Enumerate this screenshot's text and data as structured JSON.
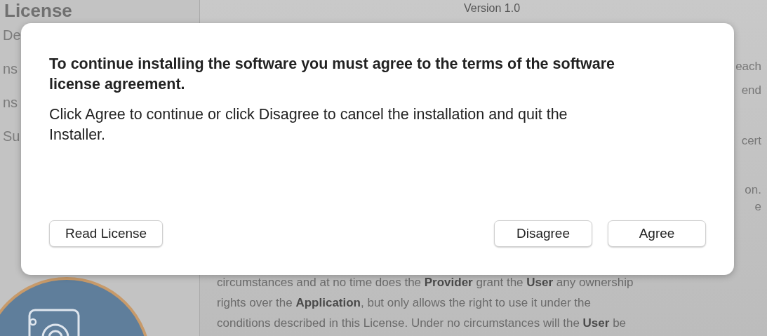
{
  "background_window": {
    "sidebar": {
      "title": "License",
      "items": [
        "De",
        "ns",
        "ns",
        "Su"
      ]
    },
    "content": {
      "version": "Version 1.0",
      "edge_fragments": [
        "each",
        "end",
        "cert",
        "on.",
        "e"
      ],
      "paragraph_lines": [
        "circumstances and at no time does the **Provider** grant the **User** any ownership",
        "rights over the **Application**, but only allows the right to use it under the",
        "conditions described in this License. Under no circumstances will the **User** be"
      ]
    }
  },
  "dialog": {
    "title": "To continue installing the software you must agree to the terms of the software license agreement.",
    "message": "Click Agree to continue or click Disagree to cancel the installation and quit the Installer.",
    "buttons": [
      {
        "label": "Read License",
        "kind": "left"
      },
      {
        "label": "Disagree",
        "kind": "right"
      },
      {
        "label": "Agree",
        "kind": "right"
      }
    ]
  }
}
